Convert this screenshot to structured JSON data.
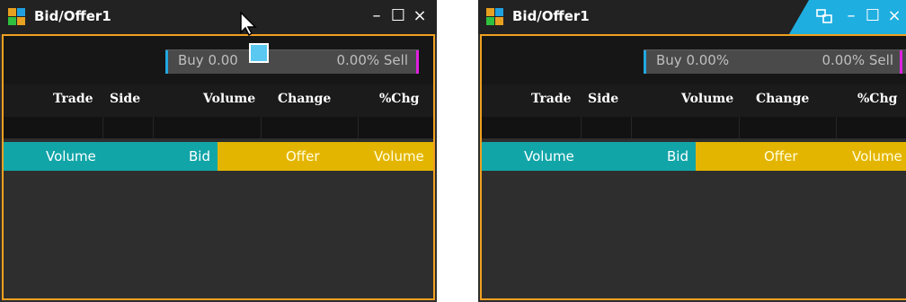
{
  "windows": [
    {
      "title": "Bid/Offer1",
      "controls": {
        "minimize": "–",
        "maximize": "☐",
        "close": "×"
      },
      "ratio": {
        "buy": "Buy 0.00",
        "sell": "0.00% Sell"
      },
      "columns": [
        "Trade",
        "Side",
        "Volume",
        "Change",
        "%Chg"
      ],
      "band": {
        "volume_left": "Volume",
        "bid": "Bid",
        "offer": "Offer",
        "volume_right": "Volume"
      }
    },
    {
      "title": "Bid/Offer1",
      "controls": {
        "minimize": "–",
        "maximize": "☐",
        "close": "×"
      },
      "ratio": {
        "buy": "Buy 0.00%",
        "sell": "0.00% Sell"
      },
      "columns": [
        "Trade",
        "Side",
        "Volume",
        "Change",
        "%Chg"
      ],
      "band": {
        "volume_left": "Volume",
        "bid": "Bid",
        "offer": "Offer",
        "volume_right": "Volume"
      }
    }
  ],
  "colors": {
    "frame": "#f0a020",
    "buy_bar": "#21a8e0",
    "sell_bar": "#e020e0",
    "bid_band": "#12a5a8",
    "offer_band": "#e4b500"
  }
}
